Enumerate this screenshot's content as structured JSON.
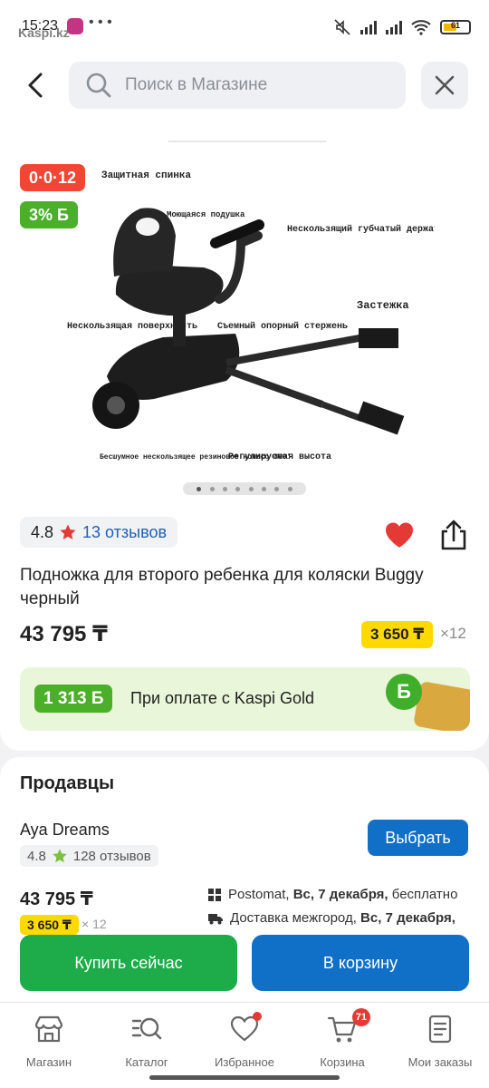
{
  "status_bar": {
    "time": "15:23",
    "overlay_brand": "Kaspi.kz",
    "more": "• • •",
    "battery": "61",
    "icons": [
      "instagram-icon",
      "mute-icon",
      "signal-icon",
      "signal-icon",
      "wifi-icon",
      "battery-icon"
    ]
  },
  "header": {
    "search_placeholder": "Поиск в Магазине",
    "back_icon": "back-arrow-icon",
    "close_icon": "close-icon"
  },
  "product": {
    "installment_badge": "0·0·12",
    "bonus_badge": "3% Б",
    "image_labels": {
      "back": "Защитная спинка",
      "cushion": "Моющаяся подушка",
      "handle": "Нескользящий губчатый держатель",
      "clamp": "Застежка",
      "surface": "Нескользящая поверхность",
      "rod": "Съемный опорный стержень",
      "wheel": "Бесшумное нескользящее резиновое колесо 360˚",
      "height": "Регулируемая высота"
    },
    "gallery_count": 8,
    "gallery_active": 0,
    "rating": "4.8",
    "reviews": "13 отзывов",
    "title": "Подножка для второго ребенка для коляски Buggy черный",
    "price": "43 795 ₸",
    "monthly_payment": "3 650 ₸",
    "monthly_term": "×12",
    "kaspi_gold": {
      "bonus": "1 313 Б",
      "text": "При оплате с Kaspi Gold",
      "coin_letter": "Б"
    }
  },
  "sellers": {
    "title": "Продавцы",
    "items": [
      {
        "name": "Aya Dreams",
        "rating": "4.8",
        "reviews": "128 отзывов",
        "choose_label": "Выбрать",
        "price": "43 795 ₸",
        "monthly_payment": "3 650 ₸",
        "monthly_term": "× 12",
        "delivery": [
          {
            "icon": "postomat-icon",
            "prefix": "Postomat,",
            "date": "Вс, 7 декабря,",
            "suffix": "бесплатно"
          },
          {
            "icon": "truck-icon",
            "prefix": "Доставка межгород,",
            "date": "Вс, 7 декабря,",
            "suffix": ""
          }
        ]
      }
    ]
  },
  "actions": {
    "buy_now": "Купить сейчас",
    "add_to_cart": "В корзину"
  },
  "tabbar": {
    "items": [
      {
        "label": "Магазин",
        "icon": "store-icon"
      },
      {
        "label": "Каталог",
        "icon": "catalog-search-icon"
      },
      {
        "label": "Избранное",
        "icon": "heart-icon",
        "dot": true
      },
      {
        "label": "Корзина",
        "icon": "cart-icon",
        "badge": "71"
      },
      {
        "label": "Мои заказы",
        "icon": "orders-icon"
      }
    ]
  },
  "colors": {
    "primary_blue": "#1070c8",
    "green": "#1eab4a",
    "bonus_green": "#4caf2a",
    "installment_red": "#f14635",
    "price_yellow": "#ffd900",
    "heart_red": "#e53935"
  }
}
